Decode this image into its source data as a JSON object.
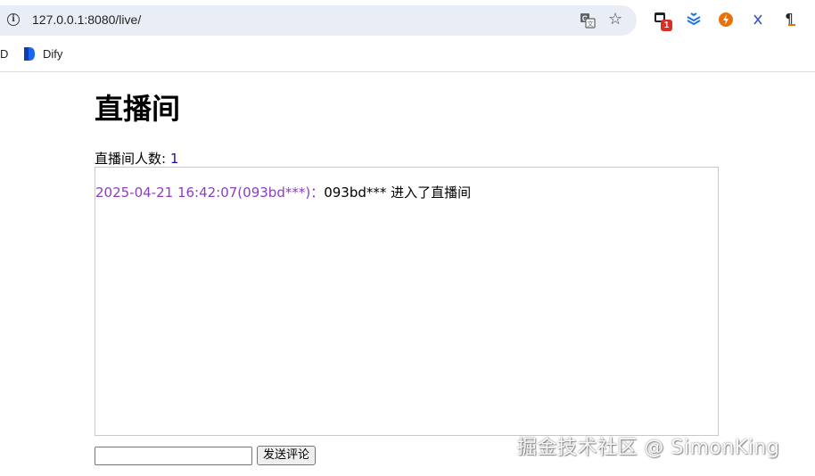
{
  "browser": {
    "url": "127.0.0.1:8080/live/",
    "extension_badge": "1",
    "bookmarks": [
      {
        "label": "D"
      },
      {
        "label": "Dify"
      }
    ]
  },
  "page": {
    "title": "直播间",
    "viewers_label": "直播间人数:",
    "viewers_count": "1",
    "messages": [
      {
        "meta": "2025-04-21 16:42:07(093bd***)：",
        "text": "093bd*** 进入了直播间"
      }
    ],
    "comment_input_value": "",
    "submit_label": "发送评论"
  },
  "watermark": "掘金技术社区 @ SimonKing",
  "colors": {
    "omnibox_bg": "#e9eef6",
    "message_meta": "#8a3fbf",
    "viewer_count": "#1a0dab"
  }
}
